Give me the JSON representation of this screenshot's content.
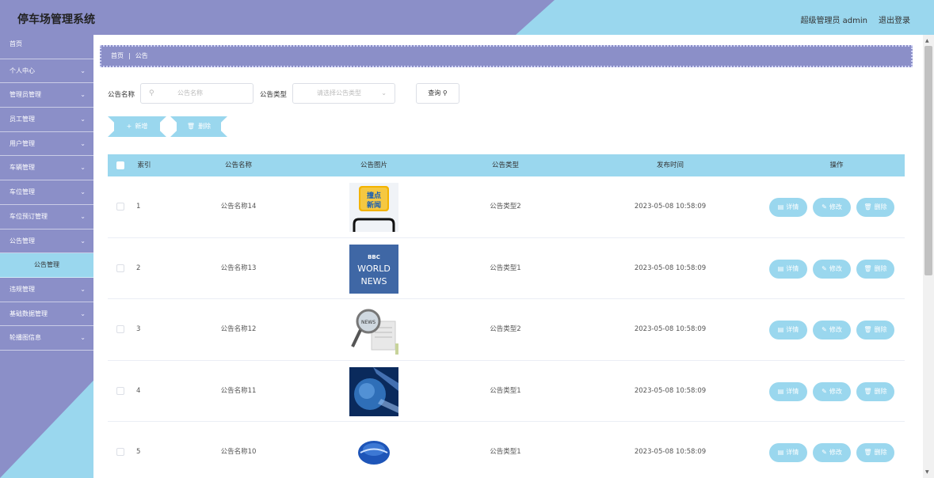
{
  "header": {
    "title": "停车场管理系统",
    "user": "超级管理员 admin",
    "logout": "退出登录"
  },
  "sidebar": {
    "items": [
      {
        "label": "首页",
        "chevron": false
      },
      {
        "label": "个人中心",
        "chevron": true
      },
      {
        "label": "管理员管理",
        "chevron": true
      },
      {
        "label": "员工管理",
        "chevron": true
      },
      {
        "label": "用户管理",
        "chevron": true
      },
      {
        "label": "车辆管理",
        "chevron": true
      },
      {
        "label": "车位管理",
        "chevron": true
      },
      {
        "label": "车位预订管理",
        "chevron": true
      },
      {
        "label": "公告管理",
        "chevron": true
      },
      {
        "label": "公告管理",
        "chevron": false,
        "sub": true
      },
      {
        "label": "违规管理",
        "chevron": true
      },
      {
        "label": "基础数据管理",
        "chevron": true
      },
      {
        "label": "轮播图信息",
        "chevron": true
      }
    ]
  },
  "breadcrumb": {
    "home": "首页",
    "sep": "|",
    "current": "公告"
  },
  "search": {
    "name_label": "公告名称",
    "name_placeholder": "公告名称",
    "type_label": "公告类型",
    "type_placeholder": "请选择公告类型",
    "query_label": "查询"
  },
  "actions": {
    "add_label": "新增",
    "delete_label": "删除"
  },
  "table": {
    "headers": [
      "索引",
      "公告名称",
      "公告图片",
      "公告类型",
      "发布时间",
      "操作"
    ],
    "rows": [
      {
        "index": "1",
        "name": "公告名称14",
        "type": "公告类型2",
        "time": "2023-05-08 10:58:09",
        "img": "news-app"
      },
      {
        "index": "2",
        "name": "公告名称13",
        "type": "公告类型1",
        "time": "2023-05-08 10:58:09",
        "img": "bbc",
        "img_text": [
          "BBC",
          "WORLD",
          "NEWS"
        ]
      },
      {
        "index": "3",
        "name": "公告名称12",
        "type": "公告类型2",
        "time": "2023-05-08 10:58:09",
        "img": "magnifier",
        "img_text": [
          "NEWS"
        ]
      },
      {
        "index": "4",
        "name": "公告名称11",
        "type": "公告类型1",
        "time": "2023-05-08 10:58:09",
        "img": "globe-blue"
      },
      {
        "index": "5",
        "name": "公告名称10",
        "type": "公告类型1",
        "time": "2023-05-08 10:58:09",
        "img": "globe-news"
      }
    ],
    "row_actions": {
      "detail": "详情",
      "edit": "修改",
      "delete": "删除"
    }
  },
  "img0_text": [
    "撞点",
    "新闻"
  ],
  "colors": {
    "purple": "#8b8fc8",
    "cyan": "#9ad7ee"
  }
}
